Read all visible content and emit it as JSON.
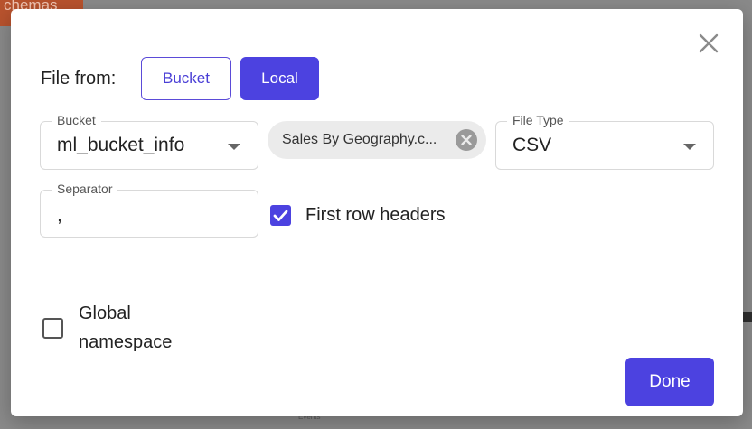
{
  "background": {
    "tab_label": "chemas",
    "footer_text": "Events"
  },
  "modal": {
    "file_from_label": "File from:",
    "source_options": [
      "Bucket",
      "Local"
    ],
    "selected_source": "Local",
    "bucket_field": {
      "label": "Bucket",
      "value": "ml_bucket_info"
    },
    "file_chip": {
      "label": "Sales By Geography.c..."
    },
    "file_type_field": {
      "label": "File Type",
      "value": "CSV"
    },
    "separator_field": {
      "label": "Separator",
      "value": ","
    },
    "first_row_headers": {
      "label": "First row headers",
      "checked": true
    },
    "global_namespace": {
      "line1": "Global",
      "line2": "namespace",
      "checked": false
    },
    "done_label": "Done",
    "colors": {
      "accent": "#4c42e0",
      "chip_bg": "#ebebeb"
    },
    "icons": {
      "close": "close-icon",
      "dropdown": "chevron-down-icon",
      "chip_remove": "cancel-circle-icon",
      "check": "check-icon"
    }
  }
}
